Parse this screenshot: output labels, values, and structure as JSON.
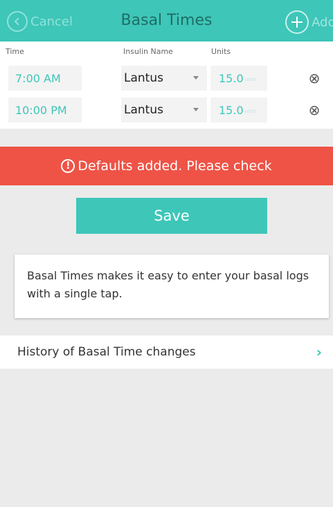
{
  "header": {
    "cancel_label": "Cancel",
    "title": "Basal Times",
    "add_label": "Add"
  },
  "table": {
    "columns": {
      "time": "Time",
      "insulin": "Insulin Name",
      "units": "Units"
    },
    "rows": [
      {
        "time": "7:00 AM",
        "insulin": "Lantus",
        "units": "15.0",
        "unit_suffix": "units"
      },
      {
        "time": "10:00 PM",
        "insulin": "Lantus",
        "units": "15.0",
        "unit_suffix": "units"
      }
    ]
  },
  "banner": {
    "text": "Defaults added. Please check",
    "icon": "!",
    "color": "#ee5346"
  },
  "save_label": "Save",
  "info_text": "Basal Times makes it easy to enter your basal logs with a single tap.",
  "history_label": "History of Basal Time changes",
  "icons": {
    "remove": "⊗",
    "chevron": "›"
  },
  "colors": {
    "accent": "#3ec6b8",
    "background": "#ebebeb"
  }
}
